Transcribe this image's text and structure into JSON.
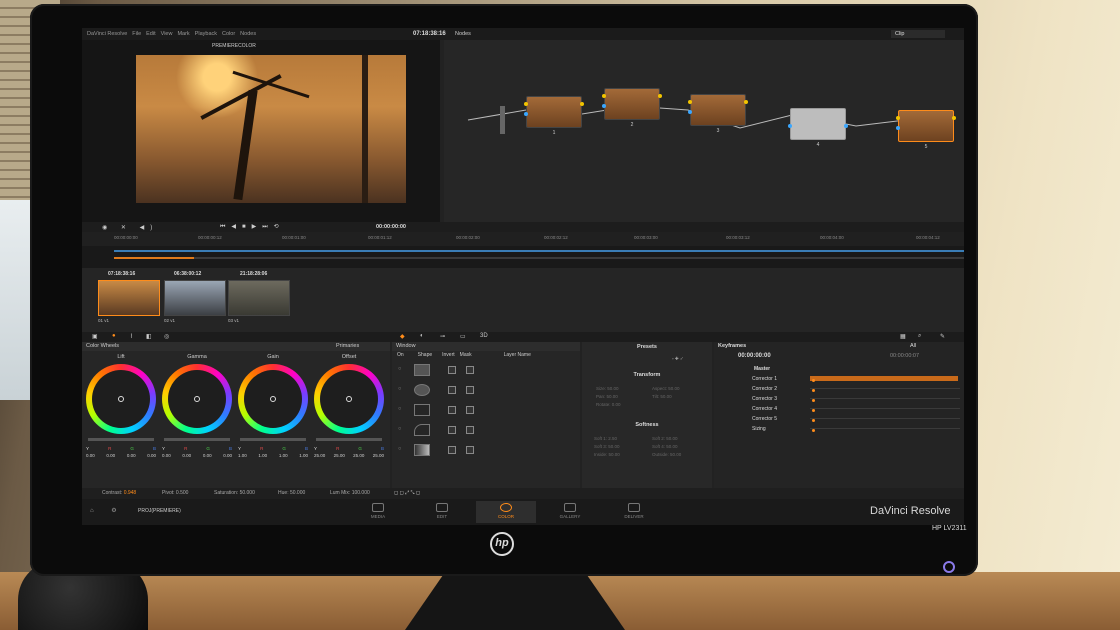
{
  "app": {
    "menu": [
      "DaVinci Resolve",
      "File",
      "Edit",
      "View",
      "Mark",
      "Playback",
      "Color",
      "Nodes"
    ],
    "viewer_timecode": "07:18:38:16",
    "viewer_tag": "PREMIERECOLOR",
    "nodes_label": "Nodes",
    "clip_selector": "Clip"
  },
  "nodes": [
    {
      "num": "1"
    },
    {
      "num": "2"
    },
    {
      "num": "3"
    },
    {
      "num": "4"
    },
    {
      "num": "5"
    }
  ],
  "transport": {
    "timecode": "00:00:00:00"
  },
  "ruler": [
    "00:00:00:00",
    "00:00:00:12",
    "00:00:01:00",
    "00:00:01:12",
    "00:00:02:00",
    "00:00:02:12",
    "00:00:03:00",
    "00:00:03:12",
    "00:00:04:00",
    "00:00:04:12"
  ],
  "thumbnails": [
    {
      "tc": "07:18:38:16",
      "label": "01 v1"
    },
    {
      "tc": "06:38:00:12",
      "label": "02 v1"
    },
    {
      "tc": "21:18:28:06",
      "label": "03 v1"
    }
  ],
  "color_wheels": {
    "title": "Color Wheels",
    "mode": "Primaries",
    "wheels": [
      {
        "name": "Lift",
        "vals": [
          "0.00",
          "0.00",
          "0.00",
          "0.00"
        ]
      },
      {
        "name": "Gamma",
        "vals": [
          "0.00",
          "0.00",
          "0.00",
          "0.00"
        ]
      },
      {
        "name": "Gain",
        "vals": [
          "1.00",
          "1.00",
          "1.00",
          "1.00"
        ]
      },
      {
        "name": "Offset",
        "vals": [
          "25.00",
          "25.00",
          "25.00",
          "25.00"
        ]
      }
    ],
    "ygrb": [
      "Y",
      "R",
      "G",
      "B"
    ]
  },
  "window_panel": {
    "title": "Window",
    "cols": [
      "On",
      "Shape",
      "Invert",
      "Mask",
      "Layer Name"
    ]
  },
  "presets": {
    "title": "Presets",
    "transform_title": "Transform",
    "transform_rows": [
      "Size: 50.00",
      "Aspect: 50.00",
      "Pan: 50.00",
      "Tilt: 50.00",
      "Rotate: 0.00"
    ],
    "softness_title": "Softness",
    "softness_rows": [
      "Soft 1: 2.50",
      "Soft 2: 50.00",
      "Soft 3: 50.00",
      "Soft 4: 50.00",
      "Inside: 50.00",
      "Outside: 50.00"
    ]
  },
  "keyframes": {
    "title": "Keyframes",
    "filter": "All",
    "timecode": "00:00:00:00",
    "end_tc": "00:00:00:07",
    "items": [
      "Master",
      "Corrector 1",
      "Corrector 2",
      "Corrector 3",
      "Corrector 4",
      "Corrector 5",
      "Sizing"
    ]
  },
  "status": {
    "contrast_label": "Contrast",
    "contrast": "0.948",
    "pivot_label": "Pivot",
    "pivot": "0.500",
    "saturation_label": "Saturation",
    "saturation": "50.000",
    "hue_label": "Hue",
    "hue": "50.000",
    "lummix_label": "Lum Mix",
    "lummix": "100.000"
  },
  "bottom_nav": {
    "project": "PROJ(PREMIERE)",
    "tabs": [
      "MEDIA",
      "EDIT",
      "COLOR",
      "GALLERY",
      "DELIVER"
    ],
    "brand": "DaVinci Resolve"
  },
  "hardware": {
    "logo": "hp",
    "model": "HP LV2311"
  },
  "colors": {
    "accent": "#ff8c1a",
    "timeline_blue": "#3a7db6",
    "panel_bg": "#262626"
  }
}
